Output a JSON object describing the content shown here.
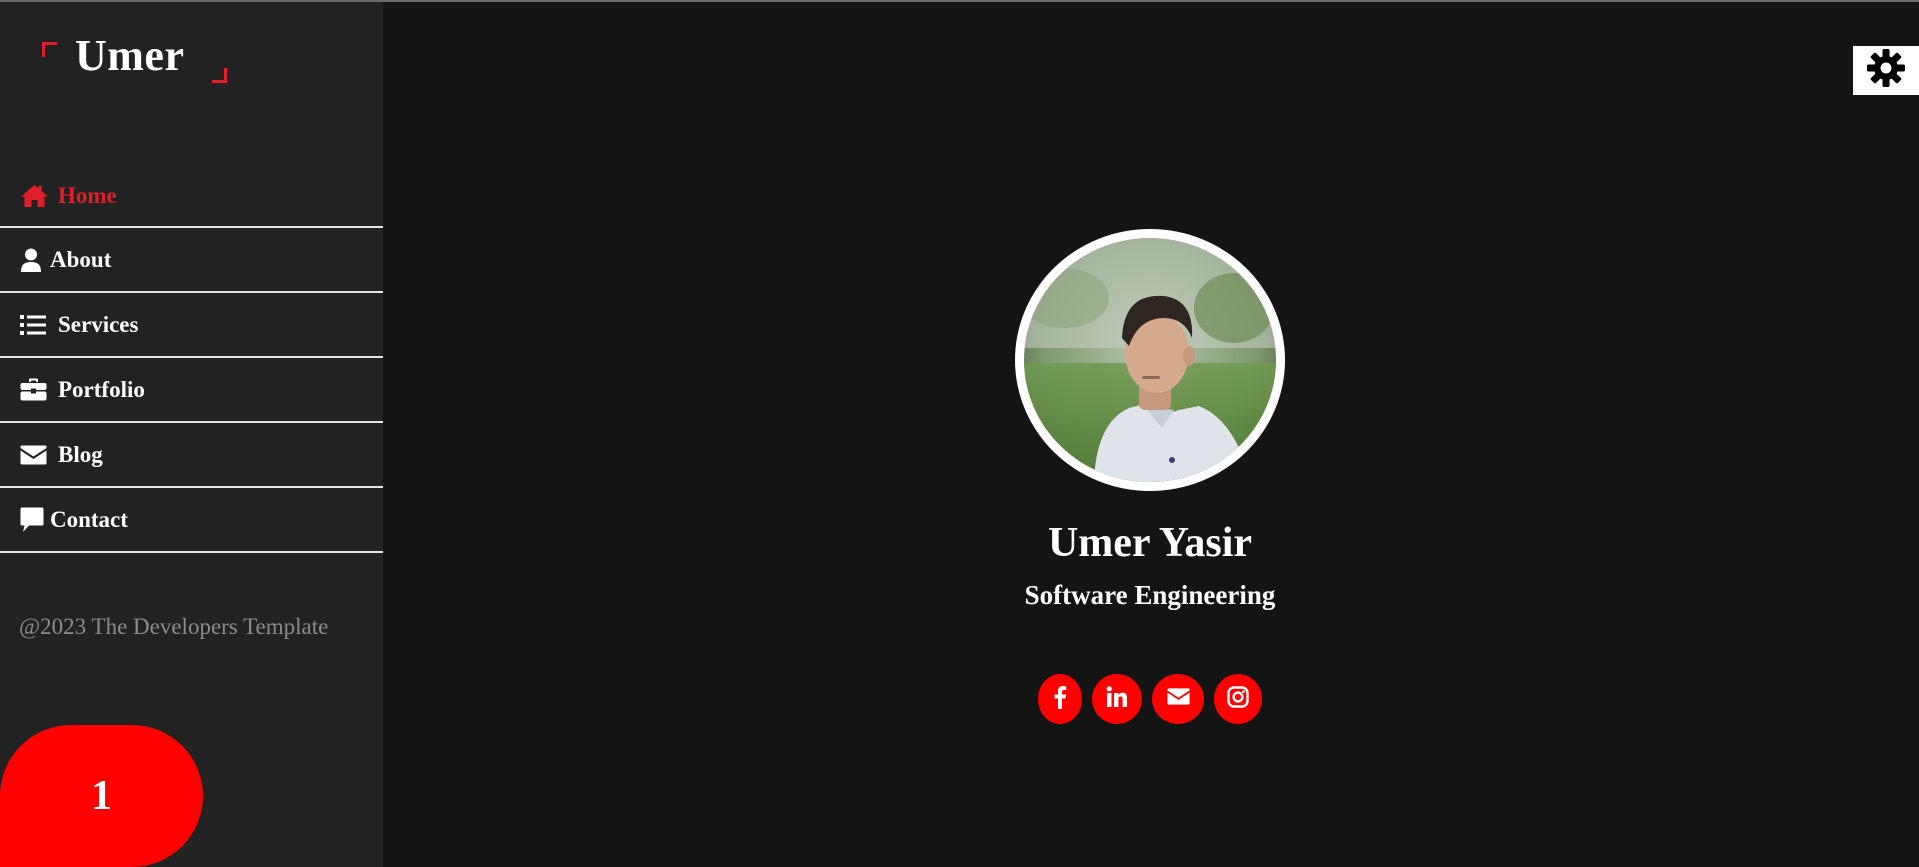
{
  "logo": {
    "text": "Umer"
  },
  "nav": {
    "items": [
      {
        "label": "Home",
        "icon": "home-icon",
        "active": true
      },
      {
        "label": "About",
        "icon": "user-icon",
        "active": false
      },
      {
        "label": "Services",
        "icon": "list-icon",
        "active": false
      },
      {
        "label": "Portfolio",
        "icon": "briefcase-icon",
        "active": false
      },
      {
        "label": "Blog",
        "icon": "envelope-icon",
        "active": false
      },
      {
        "label": "Contact",
        "icon": "comment-icon",
        "active": false
      }
    ]
  },
  "footer": {
    "copyright": "@2023 The Developers Template"
  },
  "badge": {
    "value": "1"
  },
  "hero": {
    "name": "Umer Yasir",
    "role": "Software Engineering",
    "socials": [
      {
        "icon": "facebook-icon"
      },
      {
        "icon": "linkedin-icon"
      },
      {
        "icon": "envelope-icon"
      },
      {
        "icon": "instagram-icon"
      }
    ]
  },
  "colors": {
    "accent": "#e01e2a",
    "social_bg": "#ff0000",
    "background": "#141414",
    "sidebar": "#222222"
  }
}
